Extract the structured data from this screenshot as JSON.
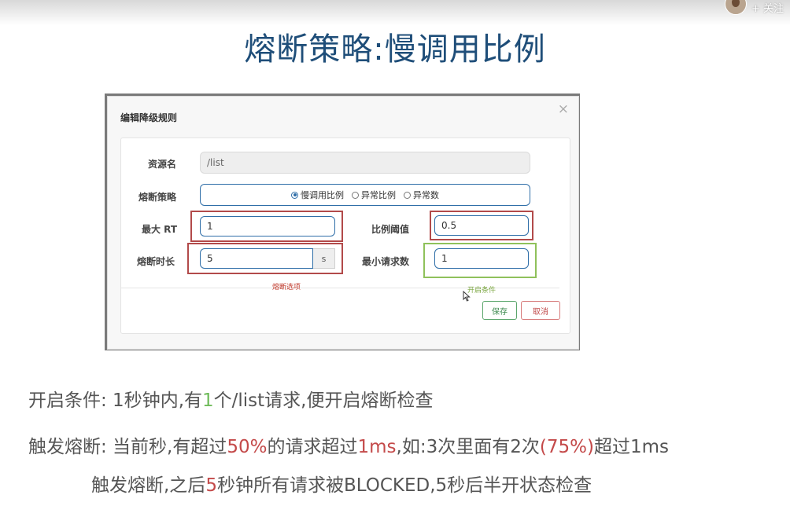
{
  "slide": {
    "title": "熔断策略:慢调用比例"
  },
  "overlay": {
    "follow_label": "+ 关注"
  },
  "modal": {
    "title": "编辑降级规则",
    "close": "×",
    "fields": {
      "resource_label": "资源名",
      "resource_value": "/list",
      "strategy_label": "熔断策略",
      "strategy_options": [
        "慢调用比例",
        "异常比例",
        "异常数"
      ],
      "strategy_selected": "慢调用比例",
      "max_rt_label": "最大 RT",
      "max_rt_value": "1",
      "ratio_label": "比例阈值",
      "ratio_value": "0.5",
      "duration_label": "熔断时长",
      "duration_value": "5",
      "duration_unit": "s",
      "min_req_label": "最小请求数",
      "min_req_value": "1"
    },
    "annotations": {
      "breaker_options": "熔断选项",
      "open_conditions": "开启条件"
    },
    "buttons": {
      "save": "保存",
      "cancel": "取消"
    }
  },
  "notes": {
    "line1": {
      "prefix": "开启条件: 1秒钟内,有",
      "count": "1",
      "suffix": "个/list请求,便开启熔断检查"
    },
    "line2": {
      "prefix": "触发熔断: 当前秒,有超过",
      "pct": "50%",
      "mid": "的请求超过",
      "ms": "1ms",
      "mid2": ",如:3次里面有2次",
      "pct2": "(75%)",
      "suffix": "超过1ms"
    },
    "line3": {
      "prefix": "触发熔断,之后",
      "secs": "5",
      "suffix": "秒钟所有请求被BLOCKED,5秒后半开状态检查"
    }
  },
  "colors": {
    "title": "#1f4e79",
    "highlight_green": "#6fbb5a",
    "highlight_red": "#c44a4a",
    "input_border": "#2f6ea8"
  }
}
